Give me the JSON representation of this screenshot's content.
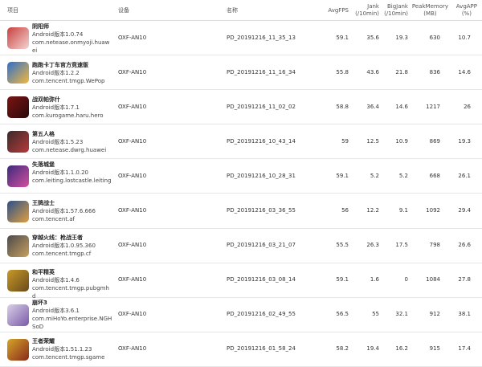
{
  "headers": {
    "item": "项目",
    "device": "设备",
    "name": "名称",
    "avgfps": "AvgFPS",
    "jank": [
      "Jank",
      "(/10min)"
    ],
    "bigjank": [
      "BigJank",
      "(/10min)"
    ],
    "peakmem": [
      "PeakMemory",
      "(MB)"
    ],
    "avgapp": [
      "AvgAPP",
      "(%)"
    ]
  },
  "rows": [
    {
      "app": "阴阳师",
      "version": "Android版本1.0.74",
      "package": "com.netease.onmyoji.huawei",
      "device": "OXF-AN10",
      "name": "PD_20191216_11_35_13",
      "avgfps": "59.1",
      "jank": "35.6",
      "bigjank": "19.3",
      "peakmem": "630",
      "avgapp": "10.7",
      "color": "#c8403f",
      "color2": "#f3d5d0",
      "icon": "yinyangshi-app-icon"
    },
    {
      "app": "跑跑卡丁车官方竞速版",
      "version": "Android版本1.2.2",
      "package": "com.tencent.tmgp.WePop",
      "device": "OXF-AN10",
      "name": "PD_20191216_11_16_34",
      "avgfps": "55.8",
      "jank": "43.6",
      "bigjank": "21.8",
      "peakmem": "836",
      "avgapp": "14.6",
      "color": "#2c6fd0",
      "color2": "#f5b83b",
      "icon": "kartrider-app-icon"
    },
    {
      "app": "战双帕弥什",
      "version": "Android版本1.7.1",
      "package": "com.kurogame.haru.hero",
      "device": "OXF-AN10",
      "name": "PD_20191216_11_02_02",
      "avgfps": "58.8",
      "jank": "36.4",
      "bigjank": "14.6",
      "peakmem": "1217",
      "avgapp": "26",
      "color": "#7a1414",
      "color2": "#2a0a0a",
      "icon": "punishing-app-icon"
    },
    {
      "app": "第五人格",
      "version": "Android版本1.5.23",
      "package": "com.netease.dwrg.huawei",
      "device": "OXF-AN10",
      "name": "PD_20191216_10_43_14",
      "avgfps": "59",
      "jank": "12.5",
      "bigjank": "10.9",
      "peakmem": "869",
      "avgapp": "19.3",
      "color": "#3a2a2a",
      "color2": "#b83a3a",
      "icon": "identityv-app-icon"
    },
    {
      "app": "失落城堡",
      "version": "Android版本1.1.0.20",
      "package": "com.leiting.lostcastle.leiting",
      "device": "OXF-AN10",
      "name": "PD_20191216_10_28_31",
      "avgfps": "59.1",
      "jank": "5.2",
      "bigjank": "5.2",
      "peakmem": "668",
      "avgapp": "26.1",
      "color": "#3c2a7a",
      "color2": "#d44fa0",
      "icon": "lostcastle-app-icon"
    },
    {
      "app": "王牌战士",
      "version": "Android版本1.57.6.666",
      "package": "com.tencent.af",
      "device": "OXF-AN10",
      "name": "PD_20191216_03_36_55",
      "avgfps": "56",
      "jank": "12.2",
      "bigjank": "9.1",
      "peakmem": "1092",
      "avgapp": "29.4",
      "color": "#2b4f8a",
      "color2": "#e0a040",
      "icon": "acefighter-app-icon"
    },
    {
      "app": "穿越火线：枪战王者",
      "version": "Android版本1.0.95.360",
      "package": "com.tencent.tmgp.cf",
      "device": "OXF-AN10",
      "name": "PD_20191216_03_21_07",
      "avgfps": "55.5",
      "jank": "26.3",
      "bigjank": "17.5",
      "peakmem": "798",
      "avgapp": "26.6",
      "color": "#4a4a4a",
      "color2": "#c9a060",
      "icon": "crossfire-app-icon"
    },
    {
      "app": "和平精英",
      "version": "Android版本1.4.6",
      "package": "com.tencent.tmgp.pubgmhd",
      "device": "OXF-AN10",
      "name": "PD_20191216_03_08_14",
      "avgfps": "59.1",
      "jank": "1.6",
      "bigjank": "0",
      "peakmem": "1084",
      "avgapp": "27.8",
      "color": "#c89a2a",
      "color2": "#6a4a1a",
      "icon": "peacekeeper-app-icon"
    },
    {
      "app": "崩坏3",
      "version": "Android版本3.6.1",
      "package": "com.miHoYo.enterprise.NGHSoD",
      "device": "OXF-AN10",
      "name": "PD_20191216_02_49_55",
      "avgfps": "56.5",
      "jank": "55",
      "bigjank": "32.1",
      "peakmem": "912",
      "avgapp": "38.1",
      "color": "#d9d0e8",
      "color2": "#7a5aa8",
      "icon": "honkai3-app-icon"
    },
    {
      "app": "王者荣耀",
      "version": "Android版本1.51.1.23",
      "package": "com.tencent.tmgp.sgame",
      "device": "OXF-AN10",
      "name": "PD_20191216_01_58_24",
      "avgfps": "58.2",
      "jank": "19.4",
      "bigjank": "16.2",
      "peakmem": "915",
      "avgapp": "17.4",
      "color": "#d4a62a",
      "color2": "#8a2a1a",
      "icon": "honorofkings-app-icon"
    }
  ]
}
